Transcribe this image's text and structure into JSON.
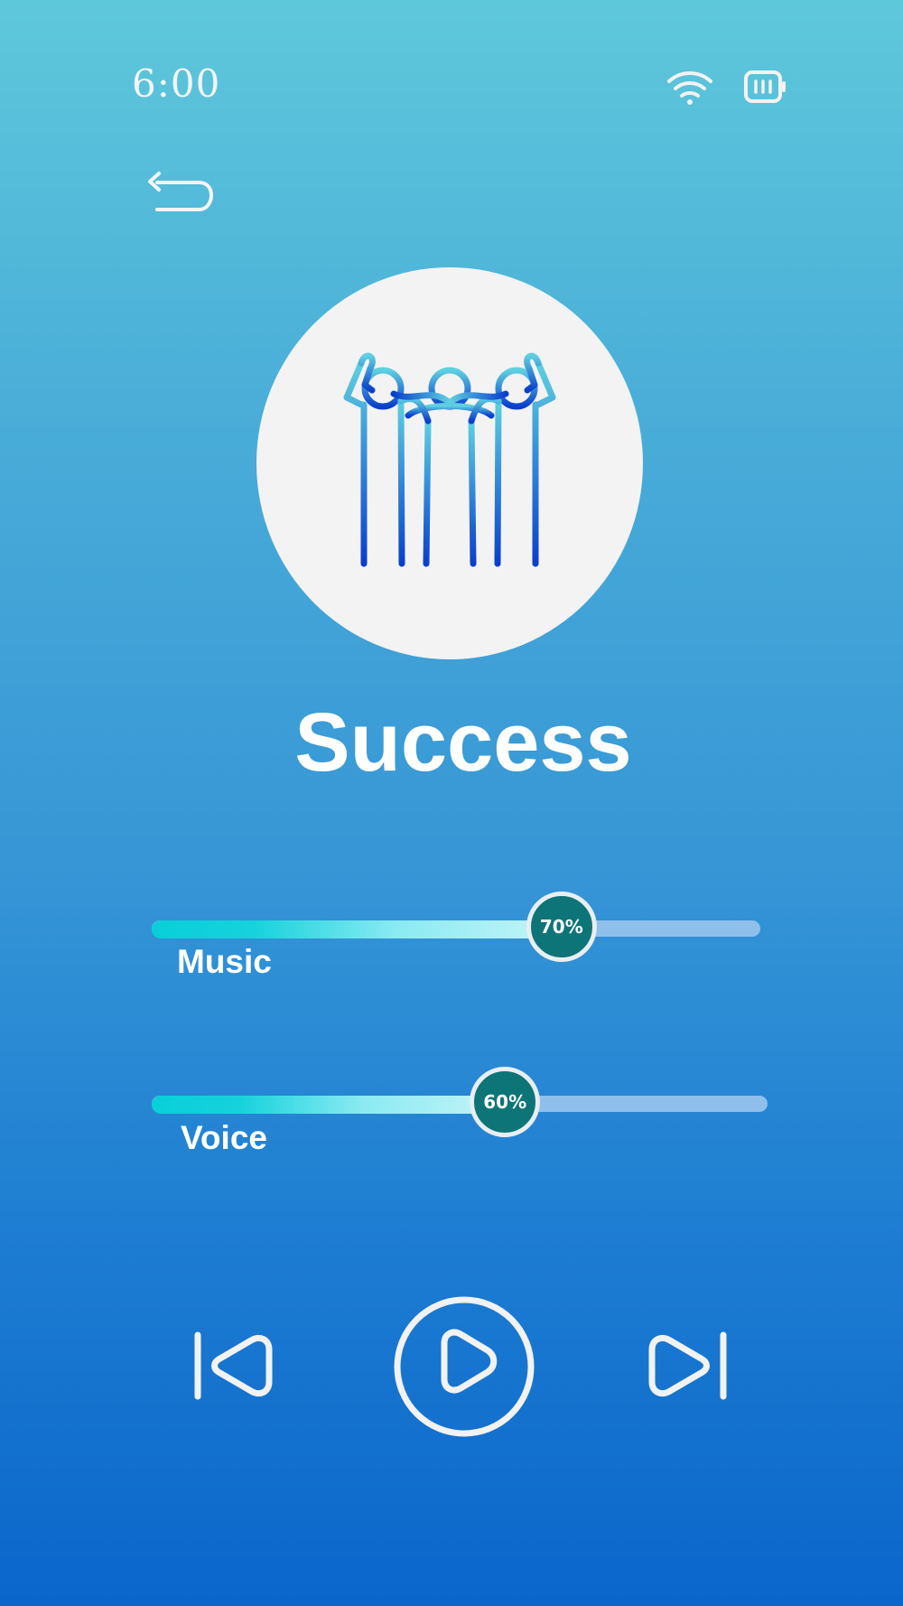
{
  "status_bar": {
    "time": "6:00",
    "wifi_icon": "wifi-icon",
    "battery_icon": "battery-icon"
  },
  "navigation": {
    "back_icon": "back-arrow-icon"
  },
  "track": {
    "title": "Success",
    "artwork_icon": "people-celebrating-icon"
  },
  "sliders": {
    "music": {
      "label": "Music",
      "value": 70,
      "value_text": "70%"
    },
    "voice": {
      "label": "Voice",
      "value": 60,
      "value_text": "60%"
    }
  },
  "controls": {
    "previous_icon": "skip-previous-icon",
    "play_icon": "play-icon",
    "next_icon": "skip-next-icon"
  },
  "colors": {
    "background_top": "#5ec8db",
    "background_bottom": "#0a66cb",
    "thumb": "#0d7577",
    "fill_start": "#08cfd9",
    "track": "#8fc0ec",
    "icon_stroke": "#f2f2f2"
  }
}
